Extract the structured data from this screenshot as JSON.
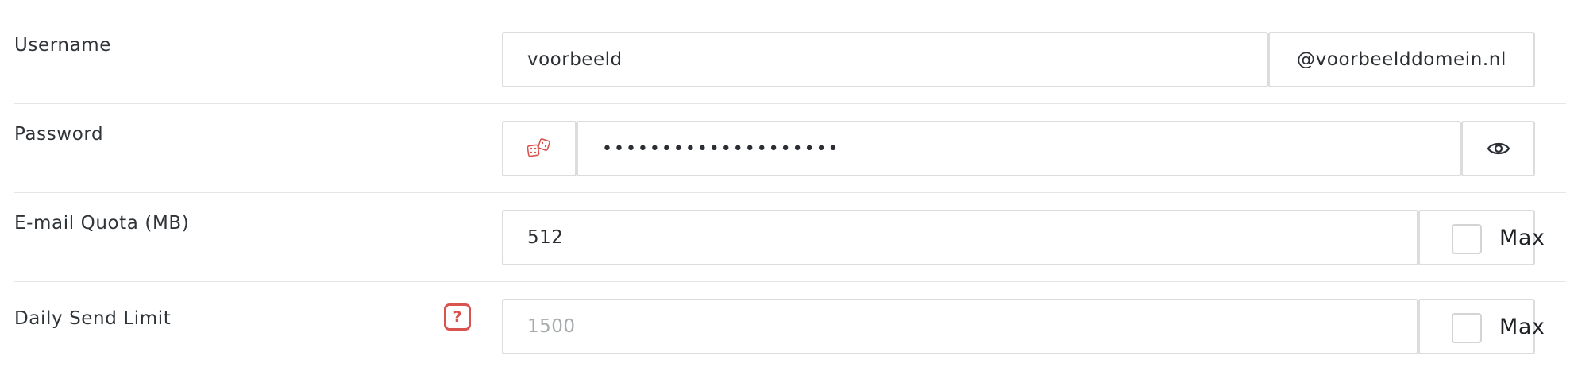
{
  "fields": {
    "username": {
      "label": "Username",
      "value": "voorbeeld",
      "domain_suffix": "@voorbeelddomein.nl"
    },
    "password": {
      "label": "Password",
      "masked_value": "••••••••••••••••••••",
      "generate_icon": "dice-icon",
      "toggle_icon": "eye-icon"
    },
    "email_quota": {
      "label": "E-mail Quota (MB)",
      "value": "512",
      "max_label": "Max",
      "max_checked": false
    },
    "daily_send_limit": {
      "label": "Daily Send Limit",
      "help_text": "?",
      "value": "",
      "placeholder": "1500",
      "max_label": "Max",
      "max_checked": false
    }
  },
  "colors": {
    "accent_red": "#d9534f",
    "border": "#dcdcdc",
    "divider": "#e6e6e6",
    "placeholder": "#a7aaad"
  }
}
